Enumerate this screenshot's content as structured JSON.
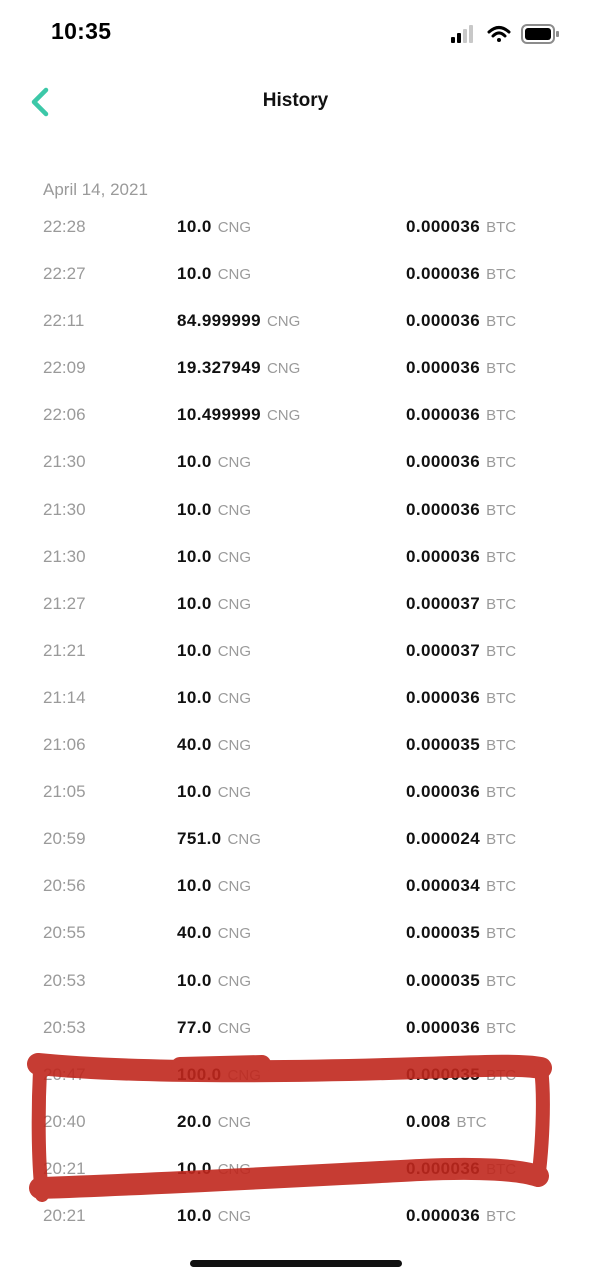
{
  "status_bar": {
    "time": "10:35"
  },
  "header": {
    "title": "History"
  },
  "history": {
    "date": "April 14, 2021",
    "rows": [
      {
        "time": "22:28",
        "amount": "10.0",
        "amount_unit": "CNG",
        "price": "0.000036",
        "price_unit": "BTC"
      },
      {
        "time": "22:27",
        "amount": "10.0",
        "amount_unit": "CNG",
        "price": "0.000036",
        "price_unit": "BTC"
      },
      {
        "time": "22:11",
        "amount": "84.999999",
        "amount_unit": "CNG",
        "price": "0.000036",
        "price_unit": "BTC"
      },
      {
        "time": "22:09",
        "amount": "19.327949",
        "amount_unit": "CNG",
        "price": "0.000036",
        "price_unit": "BTC"
      },
      {
        "time": "22:06",
        "amount": "10.499999",
        "amount_unit": "CNG",
        "price": "0.000036",
        "price_unit": "BTC"
      },
      {
        "time": "21:30",
        "amount": "10.0",
        "amount_unit": "CNG",
        "price": "0.000036",
        "price_unit": "BTC"
      },
      {
        "time": "21:30",
        "amount": "10.0",
        "amount_unit": "CNG",
        "price": "0.000036",
        "price_unit": "BTC"
      },
      {
        "time": "21:30",
        "amount": "10.0",
        "amount_unit": "CNG",
        "price": "0.000036",
        "price_unit": "BTC"
      },
      {
        "time": "21:27",
        "amount": "10.0",
        "amount_unit": "CNG",
        "price": "0.000037",
        "price_unit": "BTC"
      },
      {
        "time": "21:21",
        "amount": "10.0",
        "amount_unit": "CNG",
        "price": "0.000037",
        "price_unit": "BTC"
      },
      {
        "time": "21:14",
        "amount": "10.0",
        "amount_unit": "CNG",
        "price": "0.000036",
        "price_unit": "BTC"
      },
      {
        "time": "21:06",
        "amount": "40.0",
        "amount_unit": "CNG",
        "price": "0.000035",
        "price_unit": "BTC"
      },
      {
        "time": "21:05",
        "amount": "10.0",
        "amount_unit": "CNG",
        "price": "0.000036",
        "price_unit": "BTC"
      },
      {
        "time": "20:59",
        "amount": "751.0",
        "amount_unit": "CNG",
        "price": "0.000024",
        "price_unit": "BTC"
      },
      {
        "time": "20:56",
        "amount": "10.0",
        "amount_unit": "CNG",
        "price": "0.000034",
        "price_unit": "BTC"
      },
      {
        "time": "20:55",
        "amount": "40.0",
        "amount_unit": "CNG",
        "price": "0.000035",
        "price_unit": "BTC"
      },
      {
        "time": "20:53",
        "amount": "10.0",
        "amount_unit": "CNG",
        "price": "0.000035",
        "price_unit": "BTC"
      },
      {
        "time": "20:53",
        "amount": "77.0",
        "amount_unit": "CNG",
        "price": "0.000036",
        "price_unit": "BTC"
      },
      {
        "time": "20:47",
        "amount": "100.0",
        "amount_unit": "CNG",
        "price": "0.000035",
        "price_unit": "BTC"
      },
      {
        "time": "20:40",
        "amount": "20.0",
        "amount_unit": "CNG",
        "price": "0.008",
        "price_unit": "BTC"
      },
      {
        "time": "20:21",
        "amount": "10.0",
        "amount_unit": "CNG",
        "price": "0.000036",
        "price_unit": "BTC"
      },
      {
        "time": "20:21",
        "amount": "10.0",
        "amount_unit": "CNG",
        "price": "0.000036",
        "price_unit": "BTC"
      }
    ]
  },
  "colors": {
    "accent": "#3cc8a8",
    "annotation": "#c0271d",
    "muted_text": "#9a9a9a",
    "primary_text": "#111111"
  },
  "icons": {
    "back": "chevron-left-icon",
    "signal": "cellular-signal-icon",
    "wifi": "wifi-icon",
    "battery": "battery-icon"
  }
}
